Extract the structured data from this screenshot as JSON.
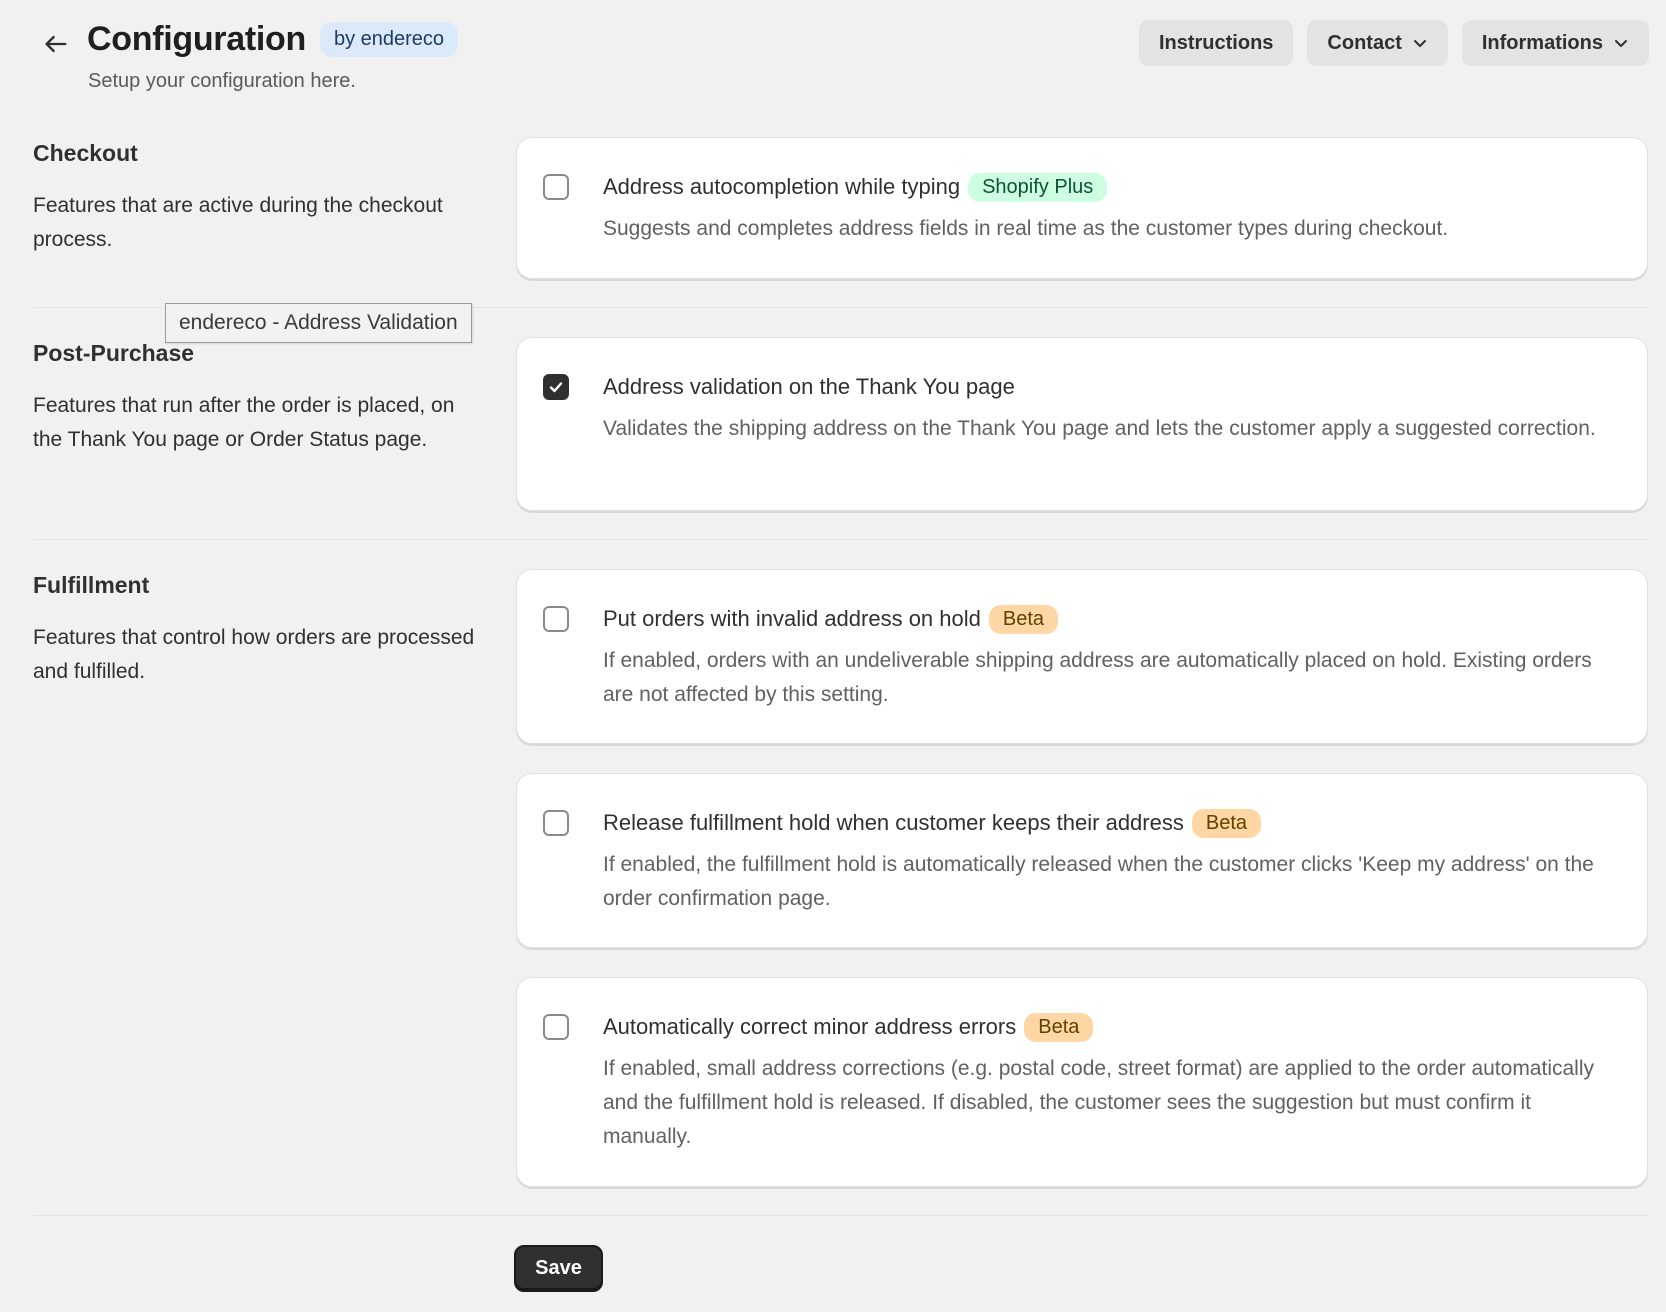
{
  "header": {
    "title": "Configuration",
    "badge": "by endereco",
    "subtitle": "Setup your configuration here.",
    "actions": {
      "instructions": "Instructions",
      "contact": "Contact",
      "informations": "Informations"
    }
  },
  "sections": {
    "checkout": {
      "heading": "Checkout",
      "description": "Features that are active during the checkout process.",
      "options": [
        {
          "title": "Address autocompletion while typing",
          "badge": "Shopify Plus",
          "description": "Suggests and completes address fields in real time as the customer types during checkout.",
          "checked": false
        }
      ]
    },
    "post_purchase": {
      "heading": "Post-Purchase",
      "description": "Features that run after the order is placed, on the Thank You page or Order Status page.",
      "options": [
        {
          "title": "Address validation on the Thank You page",
          "description": "Validates the shipping address on the Thank You page and lets the customer apply a suggested correction.",
          "checked": true
        }
      ]
    },
    "fulfillment": {
      "heading": "Fulfillment",
      "description": "Features that control how orders are processed and fulfilled.",
      "options": [
        {
          "title": "Put orders with invalid address on hold",
          "badge": "Beta",
          "description": "If enabled, orders with an undeliverable shipping address are automatically placed on hold. Existing orders are not affected by this setting.",
          "checked": false
        },
        {
          "title": "Release fulfillment hold when customer keeps their address",
          "badge": "Beta",
          "description": "If enabled, the fulfillment hold is automatically released when the customer clicks 'Keep my address' on the order confirmation page.",
          "checked": false
        },
        {
          "title": "Automatically correct minor address errors",
          "badge": "Beta",
          "description": "If enabled, small address corrections (e.g. postal code, street format) are applied to the order automatically and the fulfillment hold is released. If disabled, the customer sees the suggestion but must confirm it manually.",
          "checked": false
        }
      ]
    }
  },
  "tooltip": "endereco - Address Validation",
  "save_label": "Save",
  "icons": {
    "back": "arrow-left-icon",
    "chevron": "chevron-down-icon",
    "check": "checkmark-icon"
  },
  "colors": {
    "background": "#f1f1f1",
    "card": "#ffffff",
    "primary_button": "#303030",
    "badge_blue": "#dbe9fb",
    "badge_green": "#cdfee1",
    "badge_beta": "#ffd6a4"
  }
}
